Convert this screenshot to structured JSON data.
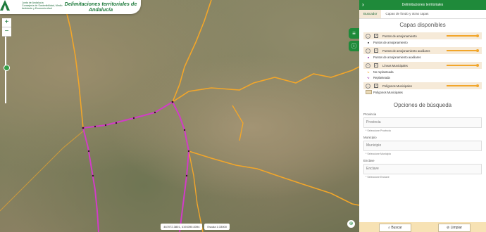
{
  "header": {
    "org_line1": "Junta de Andalucía",
    "org_line2": "Consejería de Sostenibilidad, Medio Ambiente y Economía Azul",
    "title": "Delimitaciones territoriales de Andalucía"
  },
  "zoom": {
    "in": "+",
    "out": "−"
  },
  "side_tabs": [
    "layers-icon",
    "info-icon"
  ],
  "status": {
    "coords": "467072.3801, 4193390.8394",
    "scale": "Escala 1:33000"
  },
  "panel": {
    "title": "Delimitaciones territoriales",
    "tabs": [
      "Buscador",
      "Capas de fondo y otras capas"
    ],
    "layers_title": "Capas disponibles",
    "layers": [
      {
        "name": "Puntos de amojonamiento",
        "legend": [
          {
            "symbol": "dot-black",
            "label": "Puntos de amojonamiento"
          }
        ]
      },
      {
        "name": "Puntos de amojonamiento auxiliares",
        "legend": [
          {
            "symbol": "dot-purple",
            "label": "Puntos de amojonamiento auxiliares"
          }
        ]
      },
      {
        "name": "Líneas Municipales",
        "legend": [
          {
            "symbol": "line-orange",
            "label": "No replanteada"
          },
          {
            "symbol": "line-purple",
            "label": "Replanteada"
          }
        ]
      },
      {
        "name": "Polígonos Municipales",
        "legend": [
          {
            "symbol": "poly",
            "label": "Polígonos Municipales"
          }
        ]
      }
    ],
    "search_title": "Opciones de búsqueda",
    "fields": [
      {
        "label": "Provincia",
        "placeholder": "Provincia",
        "hint": "* Seleccione Provincia"
      },
      {
        "label": "Municipio",
        "placeholder": "Municipio",
        "hint": "* Seleccione Municipio"
      },
      {
        "label": "Enclave",
        "placeholder": "Enclave",
        "hint": "* Seleccione Enclave"
      }
    ],
    "search_button": "Buscar",
    "clear_button": "Limpiar"
  },
  "colors": {
    "brand": "#1f8a3a",
    "unstaked_line": "#f2a62a",
    "staked_line": "#d23cc8"
  }
}
